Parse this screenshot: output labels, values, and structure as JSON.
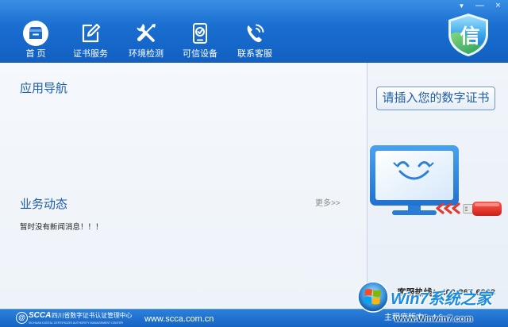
{
  "window_controls": {
    "menu": "▼",
    "minimize": "—",
    "close": "×"
  },
  "nav": {
    "items": [
      {
        "label": "首 页",
        "icon": "home-icon",
        "active": true
      },
      {
        "label": "证书服务",
        "icon": "edit-icon",
        "active": false
      },
      {
        "label": "环境检测",
        "icon": "tools-icon",
        "active": false
      },
      {
        "label": "可信设备",
        "icon": "trusted-device-icon",
        "active": false
      },
      {
        "label": "联系客服",
        "icon": "phone-icon",
        "active": false
      }
    ]
  },
  "logo": {
    "char": "信",
    "icon": "shield-icon"
  },
  "left": {
    "app_nav_title": "应用导航",
    "news_title": "业务动态",
    "more_link": "更多>>",
    "news_empty": "暂时没有新闻消息！！！"
  },
  "right": {
    "insert_button": "请插入您的数字证书",
    "illustration_icons": [
      "monitor-icon",
      "smiley-face-icon",
      "arrows-left-icon",
      "usb-key-icon"
    ],
    "hotline": "客服热线：400-867-6868"
  },
  "footer": {
    "logo_mark": "@",
    "org_abbr": "SCCA",
    "org_name": "四川省数字证书认证管理中心",
    "org_english": "SICHUAN DIGITAL CERTIFICATE AUTHORITY MANAGEMENT CENTER",
    "website": "www.scca.com.cn",
    "version": "主程序版本：4.1"
  },
  "watermark": {
    "title": "Win7系统之家",
    "url": "www.Winwin7.com",
    "icon": "windows-logo-icon"
  },
  "colors": {
    "header_top": "#3a90e4",
    "header": "#1a6fd1",
    "header_bottom": "#1160c2",
    "accent_text": "#1e5ea6",
    "footer": "#1564c5",
    "usb_red": "#e5392e"
  }
}
